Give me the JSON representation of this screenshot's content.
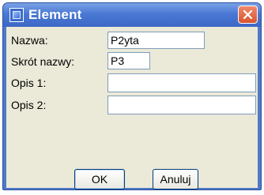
{
  "window": {
    "title": "Element",
    "icon": "app-icon",
    "close_icon": "close-icon"
  },
  "form": {
    "nazwa": {
      "label": "Nazwa:",
      "value": "P2yta"
    },
    "skrot": {
      "label": "Skrót nazwy:",
      "value": "P3"
    },
    "opis1": {
      "label": "Opis 1:",
      "value": ""
    },
    "opis2": {
      "label": "Opis 2:",
      "value": ""
    }
  },
  "buttons": {
    "ok": "OK",
    "cancel": "Anuluj"
  },
  "colors": {
    "titlebar": "#4a78d4",
    "close": "#d9542f",
    "client": "#ebe9d8",
    "field_border": "#7f9db9"
  }
}
